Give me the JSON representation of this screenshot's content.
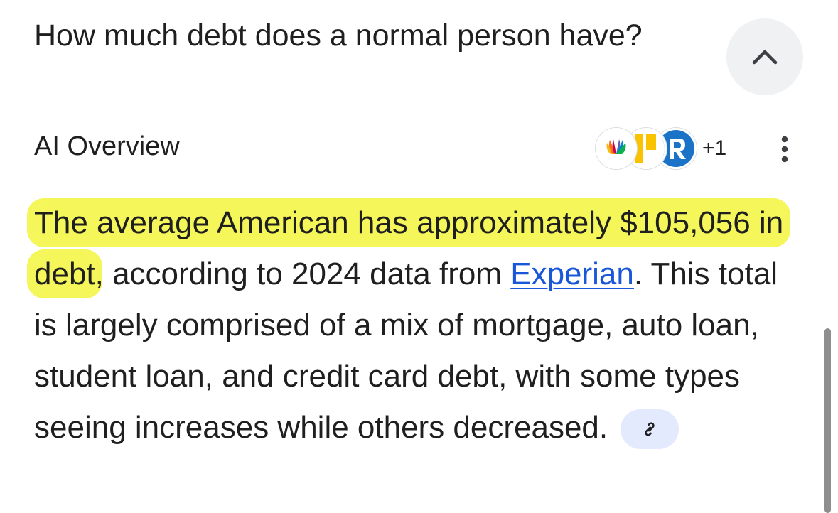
{
  "question": "How much debt does a normal person have?",
  "overview": {
    "label": "AI Overview",
    "sources_more": "+1",
    "source_icons": [
      "nbc-peacock-icon",
      "yellow-logo-icon",
      "r-logo-icon"
    ]
  },
  "answer": {
    "highlighted": "The average American has approximately $105,056 in debt",
    "after_highlight": ", according to 2024 data from ",
    "link_text": "Experian",
    "rest": ". This total is largely comprised of a mix of mortgage, auto loan, student loan, and credit card debt, with some types seeing increases while others decreased."
  },
  "colors": {
    "highlight": "#f4f65a",
    "link": "#1a57d8",
    "chip_bg": "#e4eafd"
  }
}
